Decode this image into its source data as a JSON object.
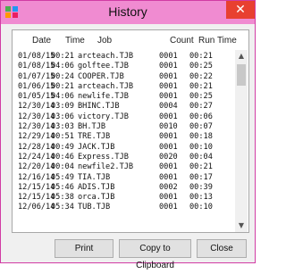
{
  "window": {
    "title": "History",
    "close_glyph": "✕",
    "icon": "app-icon"
  },
  "columns": [
    "Date",
    "Time",
    "Job",
    "Count",
    "Run Time"
  ],
  "rows": [
    [
      "01/08/15",
      "00:21",
      "arcteach.TJB",
      "0001",
      "00:21"
    ],
    [
      "01/08/15",
      "04:06",
      "golftee.TJB",
      "0001",
      "00:25"
    ],
    [
      "01/07/15",
      "00:24",
      "COOPER.TJB",
      "0001",
      "00:22"
    ],
    [
      "01/06/15",
      "00:21",
      "arcteach.TJB",
      "0001",
      "00:21"
    ],
    [
      "01/05/15",
      "04:06",
      "newlife.TJB",
      "0001",
      "00:25"
    ],
    [
      "12/30/14",
      "03:09",
      "BHINC.TJB",
      "0004",
      "00:27"
    ],
    [
      "12/30/14",
      "03:06",
      "victory.TJB",
      "0001",
      "00:06"
    ],
    [
      "12/30/14",
      "03:03",
      "BH.TJB",
      "0010",
      "00:07"
    ],
    [
      "12/29/14",
      "00:51",
      "TRE.TJB",
      "0001",
      "00:18"
    ],
    [
      "12/28/14",
      "00:49",
      "JACK.TJB",
      "0001",
      "00:10"
    ],
    [
      "12/24/14",
      "00:46",
      "Express.TJB",
      "0020",
      "00:04"
    ],
    [
      "12/20/14",
      "00:04",
      "newfile2.TJB",
      "0001",
      "00:21"
    ],
    [
      "12/16/14",
      "05:49",
      "TIA.TJB",
      "0001",
      "00:17"
    ],
    [
      "12/15/14",
      "05:46",
      "ADIS.TJB",
      "0002",
      "00:39"
    ],
    [
      "12/15/14",
      "05:38",
      "orca.TJB",
      "0001",
      "00:13"
    ],
    [
      "12/06/14",
      "05:34",
      "TUB.TJB",
      "0001",
      "00:10"
    ]
  ],
  "scrollbar": {
    "up_glyph": "▲",
    "down_glyph": "▼"
  },
  "buttons": {
    "print": "Print",
    "copy": "Copy to Clipboard",
    "close": "Close"
  },
  "colors": {
    "titlebar": "#f08bd1",
    "close": "#e84030"
  }
}
